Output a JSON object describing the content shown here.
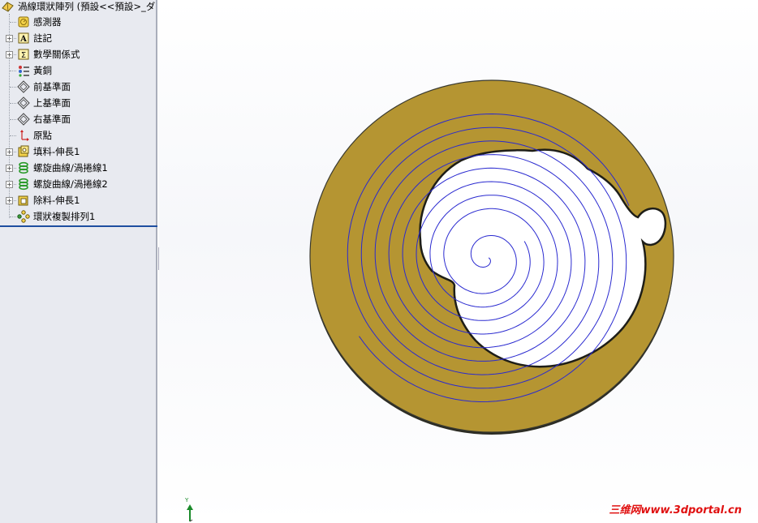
{
  "tree": {
    "root_label": "渦線環狀陣列  (預設<<預設>_ダ",
    "items": [
      {
        "label": "感測器",
        "icon": "sensor-icon",
        "expandable": false
      },
      {
        "label": "註記",
        "icon": "annotation-icon",
        "expandable": true
      },
      {
        "label": "數學關係式",
        "icon": "equation-icon",
        "expandable": true
      },
      {
        "label": "黃銅",
        "icon": "material-icon",
        "expandable": false
      },
      {
        "label": "前基準面",
        "icon": "plane-icon",
        "expandable": false
      },
      {
        "label": "上基準面",
        "icon": "plane-icon",
        "expandable": false
      },
      {
        "label": "右基準面",
        "icon": "plane-icon",
        "expandable": false
      },
      {
        "label": "原點",
        "icon": "origin-icon",
        "expandable": false
      },
      {
        "label": "填料-伸長1",
        "icon": "extrude-icon",
        "expandable": true
      },
      {
        "label": "螺旋曲線/渦捲線1",
        "icon": "helix-icon",
        "expandable": true
      },
      {
        "label": "螺旋曲線/渦捲線2",
        "icon": "helix-icon",
        "expandable": true
      },
      {
        "label": "除料-伸長1",
        "icon": "cut-extrude-icon",
        "expandable": true
      },
      {
        "label": "環狀複製排列1",
        "icon": "circular-pattern-icon",
        "expandable": false
      }
    ]
  },
  "viewport": {
    "triad_axis_label": "Y",
    "watermark": "三维网www.3dportal.cn"
  },
  "colors": {
    "brass": "#b59532",
    "brass_edge": "#3a3a30",
    "spiral": "#2a2ad0",
    "tree_bg": "#e8eaf0",
    "rollback_bar": "#1f4fa0"
  }
}
